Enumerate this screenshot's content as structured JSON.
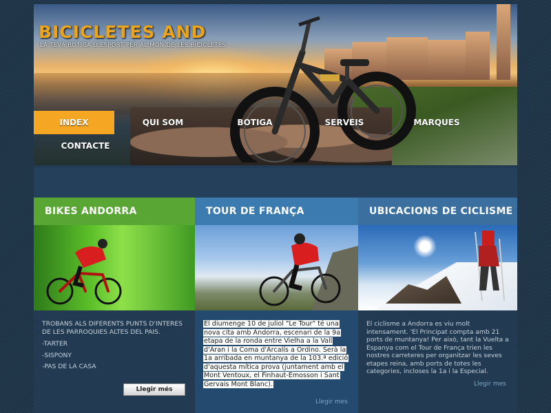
{
  "site": {
    "title": "BICICLETES AND",
    "subtitle": "LA TEVA BOTIGA D'ESPORT PER AL MÓN DE LES BICICLETES"
  },
  "nav": {
    "items": [
      {
        "label": "INDEX",
        "active": true
      },
      {
        "label": "QUI SOM",
        "active": false
      },
      {
        "label": "BOTIGA",
        "active": false
      },
      {
        "label": "SERVEIS",
        "active": false
      },
      {
        "label": "MARQUES",
        "active": false
      },
      {
        "label": "CONTACTE",
        "active": false
      }
    ]
  },
  "columns": {
    "c1": {
      "heading": "BIKES ANDORRA",
      "lead": "tROBANS ALS DIFERENTS PUNTS D'INTERES DE LES PARROQUIES ALTES DEL PAIS.",
      "list": [
        "-TARTER",
        "-SISPONY",
        "-PAS DE LA CASA"
      ],
      "button": "Llegir més"
    },
    "c2": {
      "heading": "TOUR DE FRANÇA",
      "text": "El diumenge 10 de juliol \"Le Tour\" té una nova cita amb Andorra, escenari de la 9a etapa de la ronda entre Vielha a la Vall d'Aran i la Coma d'Arcalís a Ordino. Serà la 1a arribada en muntanya de la 103.ª edició d'aquesta mítica prova (juntament amb el Mont Ventoux, el Finhaut-Emosson i Sant Gervais Mont Blanc).",
      "more": "Llegir mes"
    },
    "c3": {
      "heading": "UBICACIONS DE CICLISME",
      "text": "El ciclisme a Andorra es viu molt intensament. 'El Principat compta amb 21 ports de muntanya! Per això, tant la Vuelta a Espanya com el Tour de França trien les nostres carreteres per organitzar les seves etapes reina, amb ports de totes les categories, incloses la 1a i la Especial.",
      "more": "Llegir mes"
    }
  },
  "colors": {
    "accent": "#f5a623",
    "green_head": "#5aa634",
    "blue_head": "#3c7bb0",
    "background": "#1f3548"
  }
}
